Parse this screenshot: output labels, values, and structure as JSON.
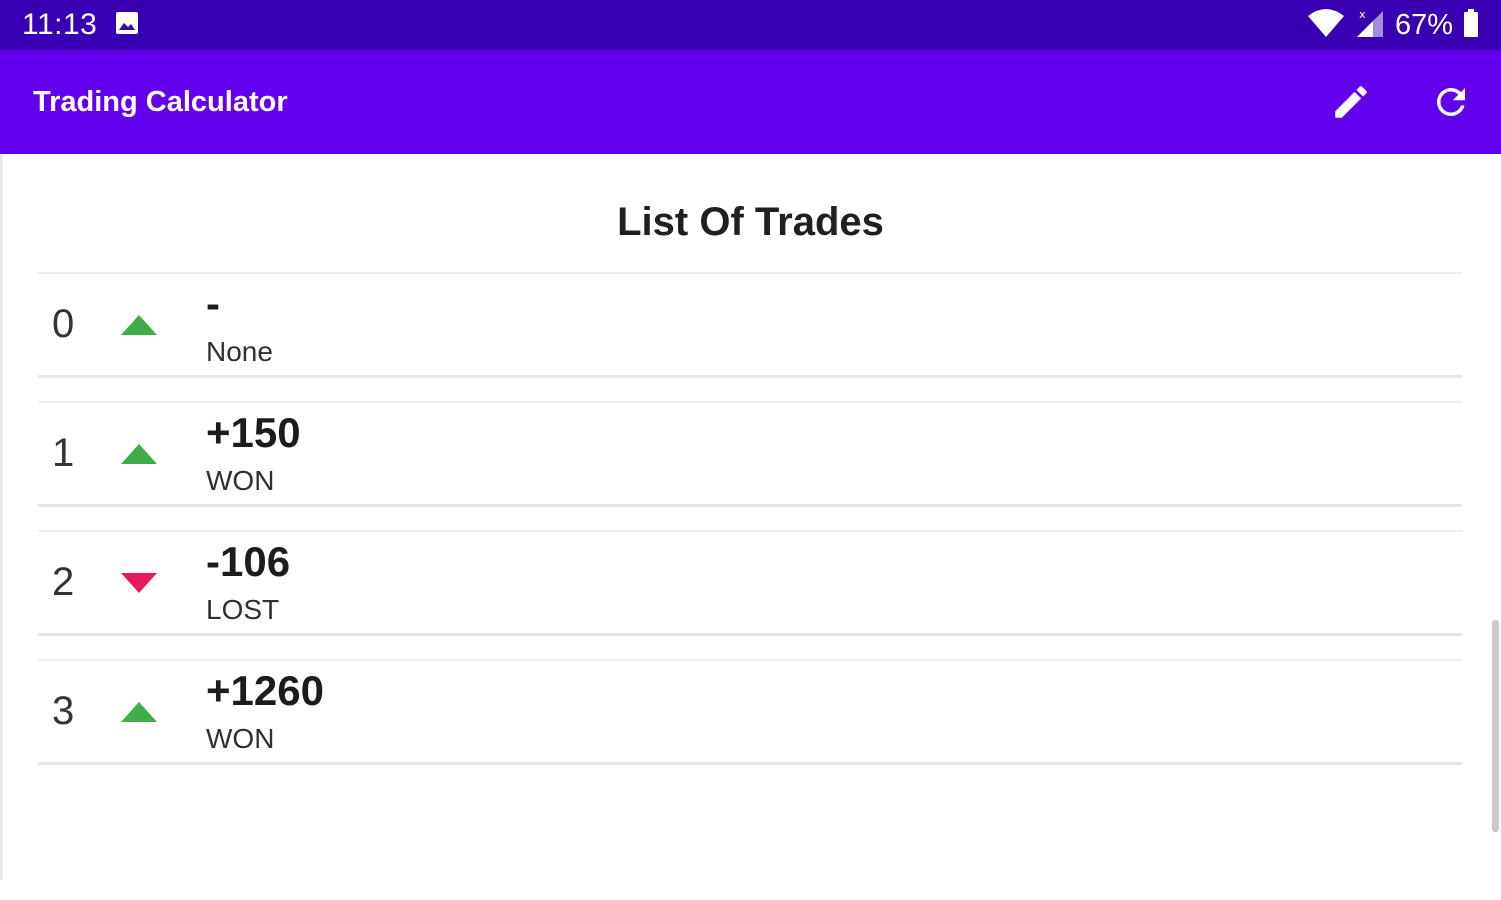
{
  "status_bar": {
    "time": "11:13",
    "battery": "67%",
    "icons": [
      "image-icon",
      "wifi-icon",
      "signal-icon",
      "battery-icon"
    ]
  },
  "app_bar": {
    "title": "Trading Calculator",
    "actions": [
      {
        "name": "edit",
        "icon": "pencil-icon"
      },
      {
        "name": "refresh",
        "icon": "refresh-icon"
      }
    ]
  },
  "list": {
    "title": "List Of Trades",
    "trades": [
      {
        "index": "0",
        "amount": "-",
        "status": "None",
        "direction": "up"
      },
      {
        "index": "1",
        "amount": "+150",
        "status": "WON",
        "direction": "up"
      },
      {
        "index": "2",
        "amount": "-106",
        "status": "LOST",
        "direction": "down"
      },
      {
        "index": "3",
        "amount": "+1260",
        "status": "WON",
        "direction": "up"
      }
    ]
  },
  "colors": {
    "status_bar": "#3700b3",
    "app_bar": "#6200ee",
    "arrow_up": "#3fae4a",
    "arrow_down": "#e8195a"
  }
}
